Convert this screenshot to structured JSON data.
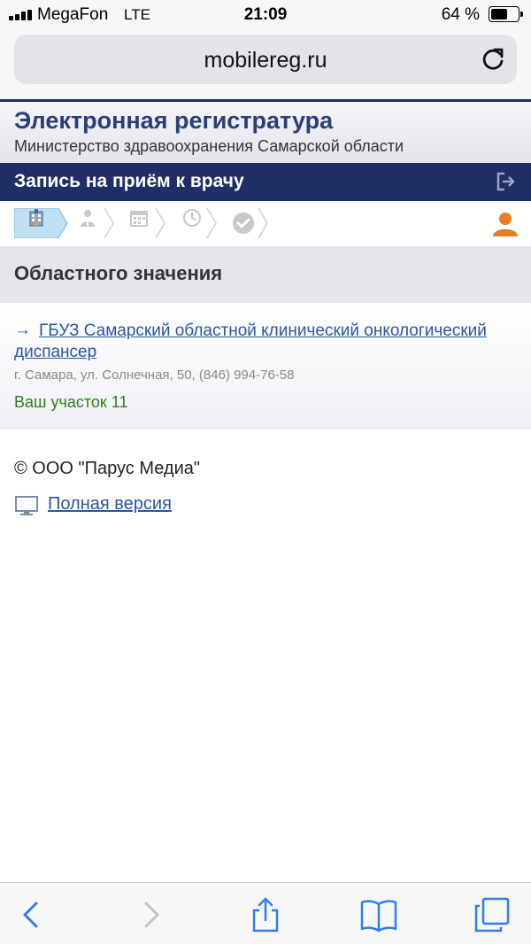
{
  "status_bar": {
    "carrier": "MegaFon",
    "network": "LTE",
    "time": "21:09",
    "battery_percent": "64 %",
    "battery_level": 0.64
  },
  "browser": {
    "url": "mobilereg.ru"
  },
  "site": {
    "title": "Электронная регистратура",
    "subtitle": "Министерство здравоохранения Самарской области"
  },
  "nav": {
    "title": "Запись на приём к врачу"
  },
  "steps": {
    "items": [
      "hospital-icon",
      "doctor-icon",
      "calendar-icon",
      "clock-icon",
      "check-icon"
    ],
    "active_index": 0
  },
  "section": {
    "title": "Областного значения"
  },
  "clinic": {
    "arrow": "→",
    "name": "ГБУЗ Самарский областной клинический онкологический диспансер",
    "address": "г. Самара, ул. Солнечная, 50, (846) 994-76-58",
    "district": "Ваш участок 11"
  },
  "footer": {
    "copyright": "© ООО \"Парус Медиа\"",
    "full_version_label": "Полная версия"
  },
  "colors": {
    "brand_dark": "#1f2f63",
    "link": "#2a56a6",
    "district": "#2e7d1e",
    "user_icon": "#e67e22"
  }
}
